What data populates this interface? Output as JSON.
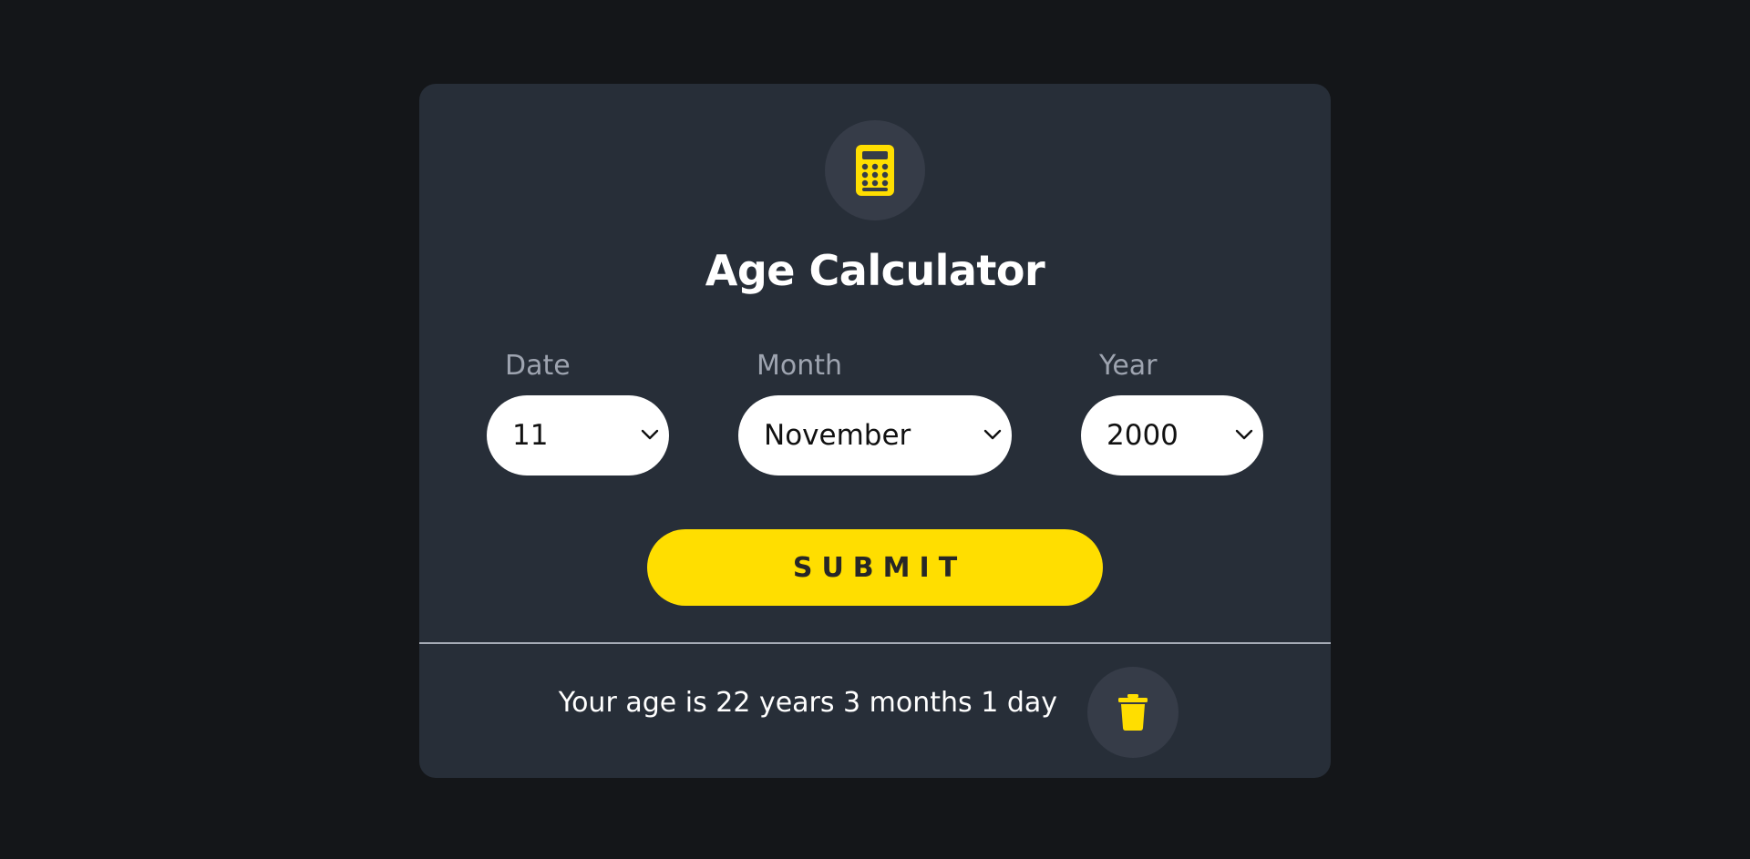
{
  "app": {
    "title": "Age Calculator",
    "icon": "calculator-icon",
    "accent_color": "#ffde00"
  },
  "form": {
    "date": {
      "label": "Date",
      "value": "11"
    },
    "month": {
      "label": "Month",
      "value": "November"
    },
    "year": {
      "label": "Year",
      "value": "2000"
    },
    "submit_label": "SUBMIT"
  },
  "result": {
    "text": "Your age is 22 years 3 months 1 day",
    "clear_icon": "trash-icon"
  }
}
